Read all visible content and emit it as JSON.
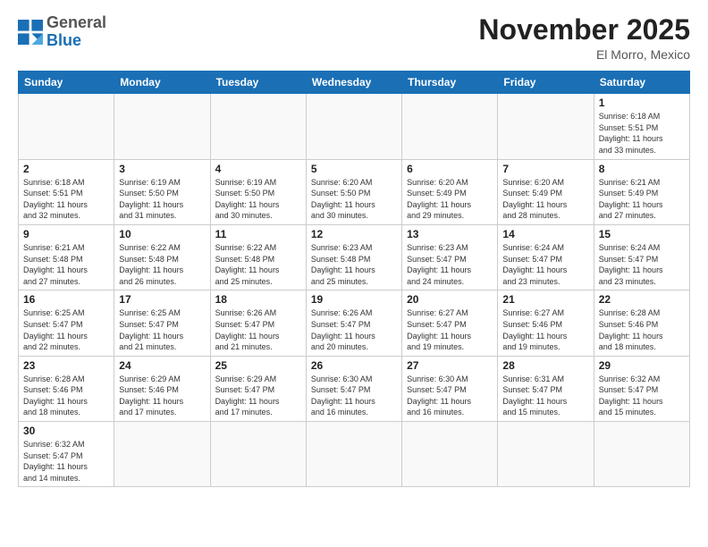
{
  "header": {
    "logo_general": "General",
    "logo_blue": "Blue",
    "month_title": "November 2025",
    "location": "El Morro, Mexico"
  },
  "weekdays": [
    "Sunday",
    "Monday",
    "Tuesday",
    "Wednesday",
    "Thursday",
    "Friday",
    "Saturday"
  ],
  "weeks": [
    [
      {
        "day": "",
        "info": ""
      },
      {
        "day": "",
        "info": ""
      },
      {
        "day": "",
        "info": ""
      },
      {
        "day": "",
        "info": ""
      },
      {
        "day": "",
        "info": ""
      },
      {
        "day": "",
        "info": ""
      },
      {
        "day": "1",
        "info": "Sunrise: 6:18 AM\nSunset: 5:51 PM\nDaylight: 11 hours\nand 33 minutes."
      }
    ],
    [
      {
        "day": "2",
        "info": "Sunrise: 6:18 AM\nSunset: 5:51 PM\nDaylight: 11 hours\nand 32 minutes."
      },
      {
        "day": "3",
        "info": "Sunrise: 6:19 AM\nSunset: 5:50 PM\nDaylight: 11 hours\nand 31 minutes."
      },
      {
        "day": "4",
        "info": "Sunrise: 6:19 AM\nSunset: 5:50 PM\nDaylight: 11 hours\nand 30 minutes."
      },
      {
        "day": "5",
        "info": "Sunrise: 6:20 AM\nSunset: 5:50 PM\nDaylight: 11 hours\nand 30 minutes."
      },
      {
        "day": "6",
        "info": "Sunrise: 6:20 AM\nSunset: 5:49 PM\nDaylight: 11 hours\nand 29 minutes."
      },
      {
        "day": "7",
        "info": "Sunrise: 6:20 AM\nSunset: 5:49 PM\nDaylight: 11 hours\nand 28 minutes."
      },
      {
        "day": "8",
        "info": "Sunrise: 6:21 AM\nSunset: 5:49 PM\nDaylight: 11 hours\nand 27 minutes."
      }
    ],
    [
      {
        "day": "9",
        "info": "Sunrise: 6:21 AM\nSunset: 5:48 PM\nDaylight: 11 hours\nand 27 minutes."
      },
      {
        "day": "10",
        "info": "Sunrise: 6:22 AM\nSunset: 5:48 PM\nDaylight: 11 hours\nand 26 minutes."
      },
      {
        "day": "11",
        "info": "Sunrise: 6:22 AM\nSunset: 5:48 PM\nDaylight: 11 hours\nand 25 minutes."
      },
      {
        "day": "12",
        "info": "Sunrise: 6:23 AM\nSunset: 5:48 PM\nDaylight: 11 hours\nand 25 minutes."
      },
      {
        "day": "13",
        "info": "Sunrise: 6:23 AM\nSunset: 5:47 PM\nDaylight: 11 hours\nand 24 minutes."
      },
      {
        "day": "14",
        "info": "Sunrise: 6:24 AM\nSunset: 5:47 PM\nDaylight: 11 hours\nand 23 minutes."
      },
      {
        "day": "15",
        "info": "Sunrise: 6:24 AM\nSunset: 5:47 PM\nDaylight: 11 hours\nand 23 minutes."
      }
    ],
    [
      {
        "day": "16",
        "info": "Sunrise: 6:25 AM\nSunset: 5:47 PM\nDaylight: 11 hours\nand 22 minutes."
      },
      {
        "day": "17",
        "info": "Sunrise: 6:25 AM\nSunset: 5:47 PM\nDaylight: 11 hours\nand 21 minutes."
      },
      {
        "day": "18",
        "info": "Sunrise: 6:26 AM\nSunset: 5:47 PM\nDaylight: 11 hours\nand 21 minutes."
      },
      {
        "day": "19",
        "info": "Sunrise: 6:26 AM\nSunset: 5:47 PM\nDaylight: 11 hours\nand 20 minutes."
      },
      {
        "day": "20",
        "info": "Sunrise: 6:27 AM\nSunset: 5:47 PM\nDaylight: 11 hours\nand 19 minutes."
      },
      {
        "day": "21",
        "info": "Sunrise: 6:27 AM\nSunset: 5:46 PM\nDaylight: 11 hours\nand 19 minutes."
      },
      {
        "day": "22",
        "info": "Sunrise: 6:28 AM\nSunset: 5:46 PM\nDaylight: 11 hours\nand 18 minutes."
      }
    ],
    [
      {
        "day": "23",
        "info": "Sunrise: 6:28 AM\nSunset: 5:46 PM\nDaylight: 11 hours\nand 18 minutes."
      },
      {
        "day": "24",
        "info": "Sunrise: 6:29 AM\nSunset: 5:46 PM\nDaylight: 11 hours\nand 17 minutes."
      },
      {
        "day": "25",
        "info": "Sunrise: 6:29 AM\nSunset: 5:47 PM\nDaylight: 11 hours\nand 17 minutes."
      },
      {
        "day": "26",
        "info": "Sunrise: 6:30 AM\nSunset: 5:47 PM\nDaylight: 11 hours\nand 16 minutes."
      },
      {
        "day": "27",
        "info": "Sunrise: 6:30 AM\nSunset: 5:47 PM\nDaylight: 11 hours\nand 16 minutes."
      },
      {
        "day": "28",
        "info": "Sunrise: 6:31 AM\nSunset: 5:47 PM\nDaylight: 11 hours\nand 15 minutes."
      },
      {
        "day": "29",
        "info": "Sunrise: 6:32 AM\nSunset: 5:47 PM\nDaylight: 11 hours\nand 15 minutes."
      }
    ],
    [
      {
        "day": "30",
        "info": "Sunrise: 6:32 AM\nSunset: 5:47 PM\nDaylight: 11 hours\nand 14 minutes."
      },
      {
        "day": "",
        "info": ""
      },
      {
        "day": "",
        "info": ""
      },
      {
        "day": "",
        "info": ""
      },
      {
        "day": "",
        "info": ""
      },
      {
        "day": "",
        "info": ""
      },
      {
        "day": "",
        "info": ""
      }
    ]
  ]
}
